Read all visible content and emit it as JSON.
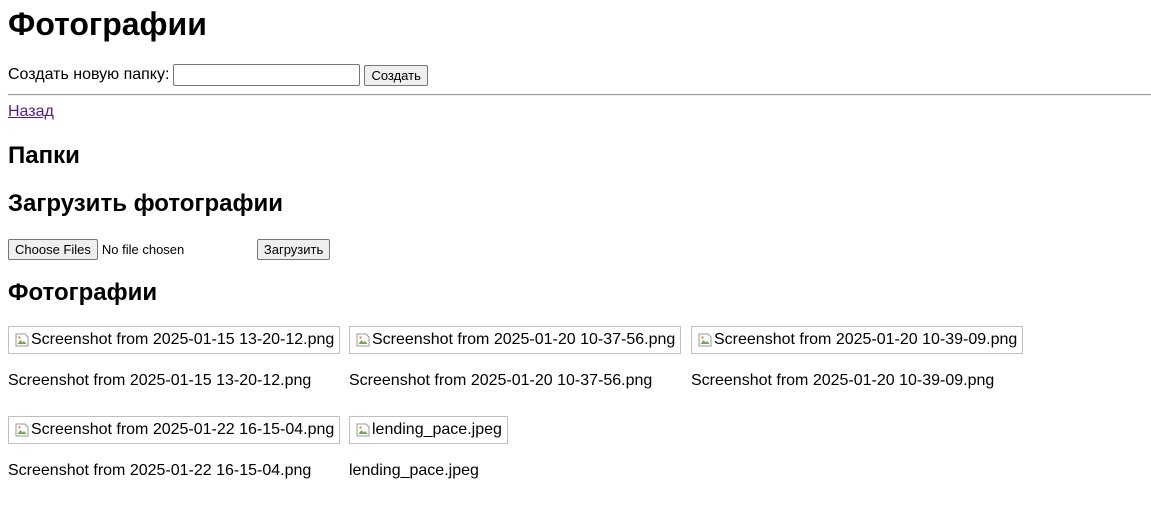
{
  "page_title": "Фотографии",
  "create_folder": {
    "label": "Создать новую папку:",
    "value": "",
    "button_label": "Создать"
  },
  "back_link": "Назад",
  "folders_heading": "Папки",
  "upload": {
    "heading": "Загрузить фотографии",
    "choose_button": "Choose Files",
    "file_status": "No file chosen",
    "submit_label": "Загрузить"
  },
  "photos_heading": "Фотографии",
  "photos": [
    {
      "alt": "Screenshot from 2025-01-15 13-20-12.png",
      "caption": "Screenshot from 2025-01-15 13-20-12.png",
      "icon": "broken-image-icon"
    },
    {
      "alt": "Screenshot from 2025-01-20 10-37-56.png",
      "caption": "Screenshot from 2025-01-20 10-37-56.png",
      "icon": "broken-image-icon"
    },
    {
      "alt": "Screenshot from 2025-01-20 10-39-09.png",
      "caption": "Screenshot from 2025-01-20 10-39-09.png",
      "icon": "broken-image-icon"
    },
    {
      "alt": "Screenshot from 2025-01-22 16-15-04.png",
      "caption": "Screenshot from 2025-01-22 16-15-04.png",
      "icon": "broken-image-icon"
    },
    {
      "alt": "lending_pace.jpeg",
      "caption": "lending_pace.jpeg",
      "icon": "broken-image-icon"
    }
  ],
  "colors": {
    "link_visited": "#551a8b",
    "button_bg": "#efefef",
    "button_border": "#767676"
  }
}
